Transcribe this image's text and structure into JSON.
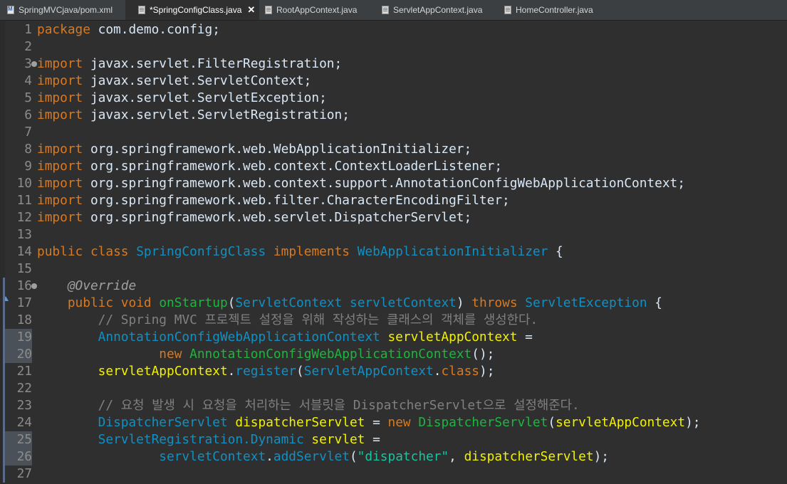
{
  "tabs": [
    {
      "label": "SpringMVCjava/pom.xml",
      "icon": "xml-file-icon",
      "active": false
    },
    {
      "label": "*SpringConfigClass.java",
      "icon": "java-file-icon",
      "active": true,
      "close": "✕"
    },
    {
      "label": "RootAppContext.java",
      "icon": "java-file-icon",
      "active": false
    },
    {
      "label": "ServletAppContext.java",
      "icon": "java-file-icon",
      "active": false
    },
    {
      "label": "HomeController.java",
      "icon": "java-file-icon",
      "active": false
    }
  ],
  "line_numbers": [
    "1",
    "2",
    "3",
    "4",
    "5",
    "6",
    "7",
    "8",
    "9",
    "10",
    "11",
    "12",
    "13",
    "14",
    "15",
    "16",
    "17",
    "18",
    "19",
    "20",
    "21",
    "22",
    "23",
    "24",
    "25",
    "26",
    "27"
  ],
  "highlighted_lines": [
    "19",
    "20",
    "25",
    "26"
  ],
  "code": [
    [
      [
        "kw",
        "package"
      ],
      [
        "plain",
        " com.demo.config;"
      ]
    ],
    [],
    [
      [
        "kw",
        "import"
      ],
      [
        "plain",
        " javax.servlet.FilterRegistration;"
      ]
    ],
    [
      [
        "kw",
        "import"
      ],
      [
        "plain",
        " javax.servlet.ServletContext;"
      ]
    ],
    [
      [
        "kw",
        "import"
      ],
      [
        "plain",
        " javax.servlet.ServletException;"
      ]
    ],
    [
      [
        "kw",
        "import"
      ],
      [
        "plain",
        " javax.servlet.ServletRegistration;"
      ]
    ],
    [],
    [
      [
        "kw",
        "import"
      ],
      [
        "plain",
        " org.springframework.web.WebApplicationInitializer;"
      ]
    ],
    [
      [
        "kw",
        "import"
      ],
      [
        "plain",
        " org.springframework.web.context.ContextLoaderListener;"
      ]
    ],
    [
      [
        "kw",
        "import"
      ],
      [
        "plain",
        " org.springframework.web.context.support.AnnotationConfigWebApplicationContext;"
      ]
    ],
    [
      [
        "kw",
        "import"
      ],
      [
        "plain",
        " org.springframework.web.filter.CharacterEncodingFilter;"
      ]
    ],
    [
      [
        "kw",
        "import"
      ],
      [
        "plain",
        " org.springframework.web.servlet.DispatcherServlet;"
      ]
    ],
    [],
    [
      [
        "kw",
        "public"
      ],
      [
        "plain",
        " "
      ],
      [
        "kw",
        "class"
      ],
      [
        "plain",
        " "
      ],
      [
        "type",
        "SpringConfigClass"
      ],
      [
        "plain",
        " "
      ],
      [
        "kw",
        "implements"
      ],
      [
        "plain",
        " "
      ],
      [
        "type",
        "WebApplicationInitializer"
      ],
      [
        "plain",
        " {"
      ]
    ],
    [],
    [
      [
        "plain",
        "    "
      ],
      [
        "anno",
        "@Override"
      ]
    ],
    [
      [
        "plain",
        "    "
      ],
      [
        "kw",
        "public"
      ],
      [
        "plain",
        " "
      ],
      [
        "kw",
        "void"
      ],
      [
        "plain",
        " "
      ],
      [
        "mth",
        "onStartup"
      ],
      [
        "plain",
        "("
      ],
      [
        "type",
        "ServletContext"
      ],
      [
        "plain",
        " "
      ],
      [
        "type",
        "servletContext"
      ],
      [
        "plain",
        ") "
      ],
      [
        "kw",
        "throws"
      ],
      [
        "plain",
        " "
      ],
      [
        "type",
        "ServletException"
      ],
      [
        "plain",
        " {"
      ]
    ],
    [
      [
        "plain",
        "        "
      ],
      [
        "cmt",
        "// Spring MVC 프로젝트 설정을 위해 작성하는 클래스의 객체를 생성한다."
      ]
    ],
    [
      [
        "plain",
        "        "
      ],
      [
        "type",
        "AnnotationConfigWebApplicationContext"
      ],
      [
        "plain",
        " "
      ],
      [
        "var",
        "servletAppContext"
      ],
      [
        "plain",
        " ="
      ]
    ],
    [
      [
        "plain",
        "                "
      ],
      [
        "kw",
        "new"
      ],
      [
        "plain",
        " "
      ],
      [
        "mth",
        "AnnotationConfigWebApplicationContext"
      ],
      [
        "plain",
        "();"
      ]
    ],
    [
      [
        "plain",
        "        "
      ],
      [
        "var",
        "servletAppContext"
      ],
      [
        "plain",
        "."
      ],
      [
        "type",
        "register"
      ],
      [
        "plain",
        "("
      ],
      [
        "type",
        "ServletAppContext"
      ],
      [
        "plain",
        "."
      ],
      [
        "kw",
        "class"
      ],
      [
        "plain",
        ");"
      ]
    ],
    [],
    [
      [
        "plain",
        "        "
      ],
      [
        "cmt",
        "// 요청 발생 시 요청을 처리하는 서블릿을 DispatcherServlet으로 설정해준다."
      ]
    ],
    [
      [
        "plain",
        "        "
      ],
      [
        "type",
        "DispatcherServlet"
      ],
      [
        "plain",
        " "
      ],
      [
        "var",
        "dispatcherServlet"
      ],
      [
        "plain",
        " = "
      ],
      [
        "kw",
        "new"
      ],
      [
        "plain",
        " "
      ],
      [
        "mth",
        "DispatcherServlet"
      ],
      [
        "plain",
        "("
      ],
      [
        "var",
        "servletAppContext"
      ],
      [
        "plain",
        ");"
      ]
    ],
    [
      [
        "plain",
        "        "
      ],
      [
        "type",
        "ServletRegistration.Dynamic"
      ],
      [
        "plain",
        " "
      ],
      [
        "var",
        "servlet"
      ],
      [
        "plain",
        " ="
      ]
    ],
    [
      [
        "plain",
        "                "
      ],
      [
        "type",
        "servletContext"
      ],
      [
        "plain",
        "."
      ],
      [
        "type",
        "addServlet"
      ],
      [
        "plain",
        "("
      ],
      [
        "str",
        "\"dispatcher\""
      ],
      [
        "plain",
        ", "
      ],
      [
        "var",
        "dispatcherServlet"
      ],
      [
        "plain",
        ");"
      ]
    ],
    []
  ],
  "colors": {
    "background": "#2f2f2f",
    "keyword": "#d77a22",
    "type": "#1290c3",
    "string": "#17c6a3",
    "variable": "#f2f200",
    "method": "#1eb540",
    "comment": "#808080",
    "annotation": "#a0a0a0"
  }
}
